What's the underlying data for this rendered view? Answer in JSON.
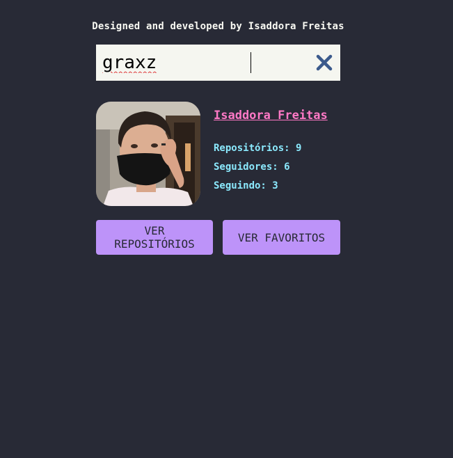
{
  "header": {
    "credit": "Designed and developed by Isaddora Freitas"
  },
  "search": {
    "value": "graxz",
    "clear_icon": "close-icon",
    "clear_color": "#3b5a8c"
  },
  "profile": {
    "name": "Isaddora Freitas",
    "stats": [
      {
        "label": "Repositórios:",
        "value": "9"
      },
      {
        "label": "Seguidores:",
        "value": "6"
      },
      {
        "label": "Seguindo:",
        "value": "3"
      }
    ]
  },
  "actions": {
    "repos_label": "VER REPOSITÓRIOS",
    "favorites_label": "VER FAVORITOS"
  },
  "colors": {
    "background": "#282a36",
    "accent_pink": "#ff79c6",
    "accent_cyan": "#8be9fd",
    "button_purple": "#bd93f9"
  }
}
